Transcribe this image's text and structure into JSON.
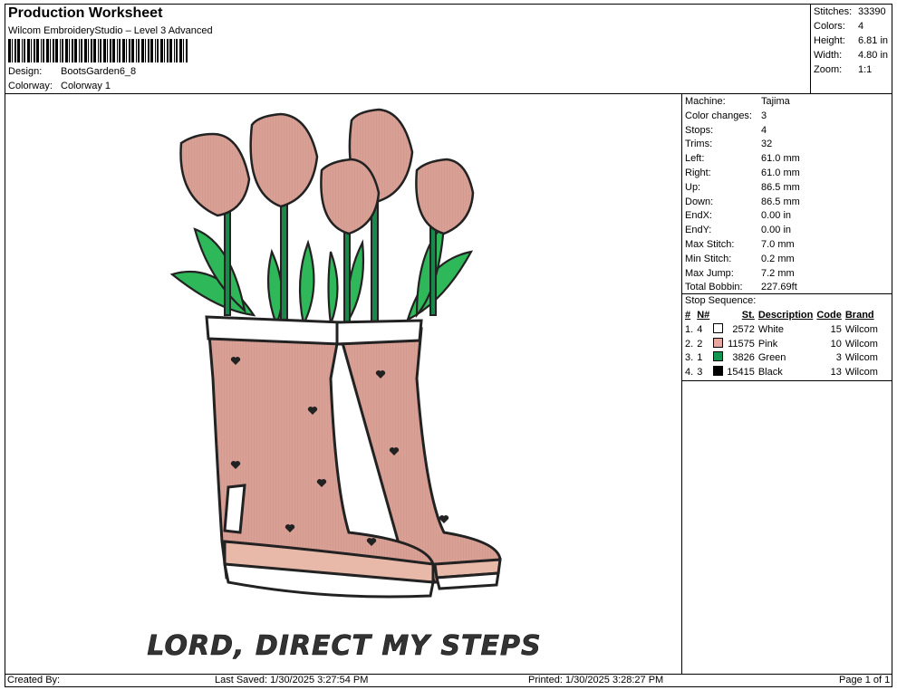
{
  "header": {
    "title": "Production Worksheet",
    "software": "Wilcom EmbroideryStudio – Level 3 Advanced",
    "design_label": "Design:",
    "design_value": "BootsGarden6_8",
    "colorway_label": "Colorway:",
    "colorway_value": "Colorway 1"
  },
  "stats": [
    {
      "k": "Stitches:",
      "v": "33390"
    },
    {
      "k": "Colors:",
      "v": "4"
    },
    {
      "k": "Height:",
      "v": "6.81 in"
    },
    {
      "k": "Width:",
      "v": "4.80 in"
    },
    {
      "k": "Zoom:",
      "v": "1:1"
    }
  ],
  "machine": [
    {
      "k": "Machine:",
      "v": "Tajima"
    },
    {
      "k": "Color changes:",
      "v": "3"
    },
    {
      "k": "Stops:",
      "v": "4"
    },
    {
      "k": "Trims:",
      "v": "32"
    },
    {
      "k": "Left:",
      "v": "61.0 mm"
    },
    {
      "k": "Right:",
      "v": "61.0 mm"
    },
    {
      "k": "Up:",
      "v": "86.5 mm"
    },
    {
      "k": "Down:",
      "v": "86.5 mm"
    },
    {
      "k": "EndX:",
      "v": "0.00 in"
    },
    {
      "k": "EndY:",
      "v": "0.00 in"
    },
    {
      "k": "Max Stitch:",
      "v": "7.0 mm"
    },
    {
      "k": "Min Stitch:",
      "v": "0.2 mm"
    },
    {
      "k": "Max Jump:",
      "v": "7.2 mm"
    },
    {
      "k": "Total Bobbin:",
      "v": "227.69ft"
    }
  ],
  "sequence": {
    "title": "Stop Sequence:",
    "headers": [
      "#",
      "N#",
      "St.",
      "Description",
      "Code",
      "Brand"
    ],
    "rows": [
      {
        "n": "1.",
        "nn": "4",
        "color": "#ffffff",
        "st": "2572",
        "desc": "White",
        "code": "15",
        "brand": "Wilcom"
      },
      {
        "n": "2.",
        "nn": "2",
        "color": "#e8a6a0",
        "st": "11575",
        "desc": "Pink",
        "code": "10",
        "brand": "Wilcom"
      },
      {
        "n": "3.",
        "nn": "1",
        "color": "#109650",
        "st": "3826",
        "desc": "Green",
        "code": "3",
        "brand": "Wilcom"
      },
      {
        "n": "4.",
        "nn": "3",
        "color": "#000000",
        "st": "15415",
        "desc": "Black",
        "code": "13",
        "brand": "Wilcom"
      }
    ]
  },
  "design_text": "LORD, DIRECT MY STEPS",
  "footer": {
    "created": "Created By:",
    "saved": "Last Saved: 1/30/2025 3:27:54 PM",
    "printed": "Printed: 1/30/2025 3:28:27 PM",
    "page": "Page 1 of 1"
  },
  "colors": {
    "pink": "#d9a096",
    "green": "#2fb85a",
    "dark_green": "#18894a",
    "black": "#222222"
  }
}
